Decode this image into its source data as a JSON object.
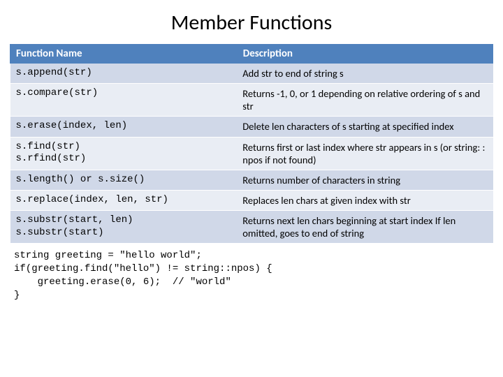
{
  "title": "Member Functions",
  "headers": {
    "c1": "Function Name",
    "c2": "Description"
  },
  "rows": [
    {
      "fn": "s.append(str)",
      "desc": "Add str to end of string s"
    },
    {
      "fn": "s.compare(str)",
      "desc": "Returns -1, 0, or 1 depending on relative ordering of s and str"
    },
    {
      "fn": "s.erase(index, len)",
      "desc": "Delete len characters of s starting at specified index"
    },
    {
      "fn": "s.find(str)\ns.rfind(str)",
      "desc": "Returns first or last index where str appears in s (or string: : npos if not found)"
    },
    {
      "fn": "s.length() or s.size()",
      "desc": "Returns number of characters in string"
    },
    {
      "fn": "s.replace(index, len, str)",
      "desc": "Replaces len chars at given index with str"
    },
    {
      "fn": "s.substr(start, len)\ns.substr(start)",
      "desc": "Returns next len chars beginning at start index\nIf len omitted, goes to end of string"
    }
  ],
  "code": "string greeting = \"hello world\";\nif(greeting.find(\"hello\") != string::npos) {\n    greeting.erase(0, 6);  // \"world\"\n}"
}
